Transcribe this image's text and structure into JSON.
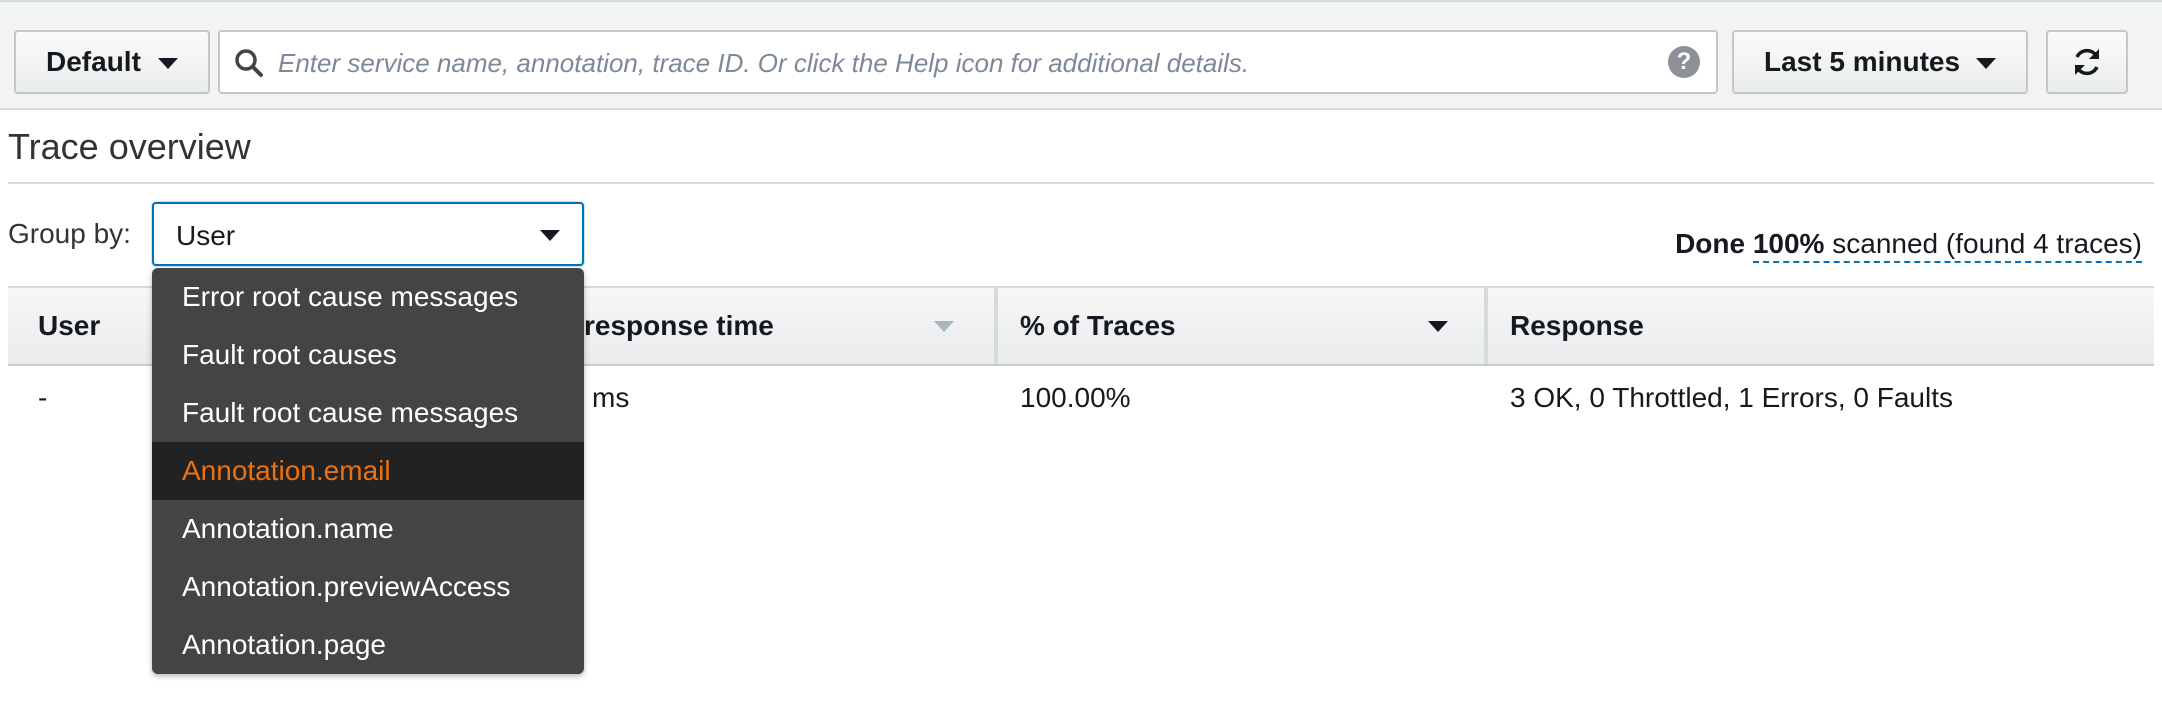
{
  "toolbar": {
    "preset_label": "Default",
    "search_placeholder": "Enter service name, annotation, trace ID. Or click the Help icon for additional details.",
    "help_glyph": "?",
    "time_range_label": "Last 5 minutes",
    "refresh_glyph": "⟳"
  },
  "page": {
    "title": "Trace overview"
  },
  "group_by": {
    "label": "Group by:",
    "selected": "User",
    "options": [
      "Error root cause messages",
      "Fault root causes",
      "Fault root cause messages",
      "Annotation.email",
      "Annotation.name",
      "Annotation.previewAccess",
      "Annotation.page"
    ],
    "highlighted_option": "Annotation.email"
  },
  "scan_status": {
    "prefix": "Done",
    "percent": "100%",
    "suffix": "scanned (found 4 traces)"
  },
  "table": {
    "columns": [
      "User",
      "response time",
      "% of Traces",
      "Response"
    ],
    "rows": [
      {
        "user": "-",
        "response_time": "ms",
        "pct_traces": "100.00%",
        "response": "3 OK, 0 Throttled, 1 Errors, 0 Faults"
      }
    ]
  },
  "colors": {
    "accent_blue": "#0073bb",
    "highlight_orange": "#ec7211",
    "menu_bg": "#444444"
  }
}
